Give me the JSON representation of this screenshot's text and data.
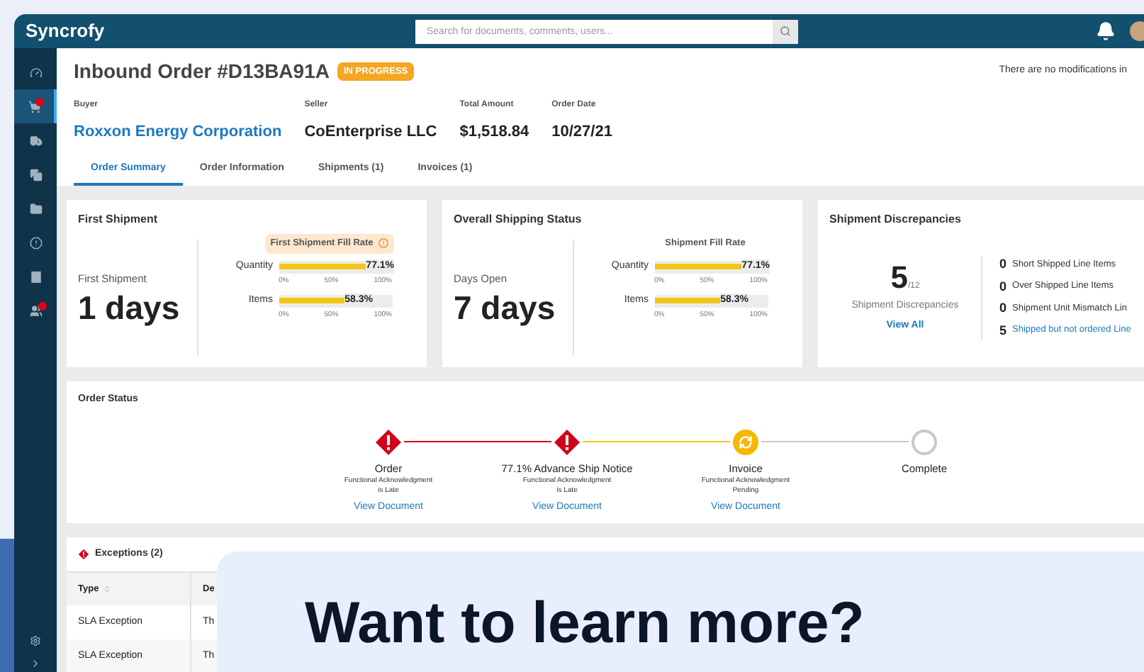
{
  "header": {
    "logo": "Syncrofy",
    "search_placeholder": "Search for documents, comments, users..."
  },
  "sidebar": {
    "items": [
      {
        "selected": false,
        "badge": false
      },
      {
        "selected": true,
        "badge": true
      },
      {
        "selected": false,
        "badge": false
      },
      {
        "selected": false,
        "badge": false
      },
      {
        "selected": false,
        "badge": false
      },
      {
        "selected": false,
        "badge": false
      },
      {
        "selected": false,
        "badge": false
      },
      {
        "selected": false,
        "badge": true
      }
    ]
  },
  "order": {
    "title": "Inbound Order #D13BA91A",
    "status": "IN PROGRESS",
    "note": "There are no modifications in",
    "meta": [
      {
        "label": "Buyer",
        "value": "Roxxon Energy Corporation",
        "link": true
      },
      {
        "label": "Seller",
        "value": "CoEnterprise LLC",
        "link": false
      },
      {
        "label": "Total Amount",
        "value": "$1,518.84",
        "link": false
      },
      {
        "label": "Order Date",
        "value": "10/27/21",
        "link": false
      }
    ],
    "tabs": [
      {
        "label": "Order Summary",
        "selected": true
      },
      {
        "label": "Order Information",
        "selected": false
      },
      {
        "label": "Shipments (1)",
        "selected": false
      },
      {
        "label": "Invoices (1)",
        "selected": false
      }
    ]
  },
  "summary_cards": [
    {
      "title": "First Shipment",
      "stat_label": "First Shipment",
      "stat_value": "1 days",
      "rate_title": "First Shipment Fill Rate",
      "warning": true,
      "bars": [
        {
          "label": "Quantity",
          "level": 0.771,
          "reading": "77.1%",
          "ticks": [
            "0%",
            "50%",
            "100%"
          ]
        },
        {
          "label": "Items",
          "level": 0.583,
          "reading": "58.3%",
          "ticks": [
            "0%",
            "50%",
            "100%"
          ]
        }
      ]
    },
    {
      "title": "Overall Shipping Status",
      "stat_label": "Days Open",
      "stat_value": "7 days",
      "rate_title": "Shipment Fill Rate",
      "warning": false,
      "bars": [
        {
          "label": "Quantity",
          "level": 0.771,
          "reading": "77.1%",
          "ticks": [
            "0%",
            "50%",
            "100%"
          ]
        },
        {
          "label": "Items",
          "level": 0.583,
          "reading": "58.3%",
          "ticks": [
            "0%",
            "50%",
            "100%"
          ]
        }
      ]
    }
  ],
  "discrepancies": {
    "title": "Shipment Discrepancies",
    "count": "5",
    "total": "/12",
    "label": "Shipment Discrepancies",
    "link": "View All",
    "items": [
      {
        "count": "0",
        "label": "Short Shipped Line Items",
        "link": false
      },
      {
        "count": "0",
        "label": "Over Shipped Line Items",
        "link": false
      },
      {
        "count": "0",
        "label": "Shipment Unit Mismatch Lin",
        "link": false
      },
      {
        "count": "5",
        "label": "Shipped but not ordered Line",
        "link": true
      }
    ]
  },
  "order_status": {
    "title": "Order Status",
    "steps": [
      {
        "name": "Order",
        "notes": [
          "Functional Acknowledgment",
          "is Late"
        ],
        "link": "View Document",
        "kind": "late"
      },
      {
        "name": "77.1% Advance Ship Notice",
        "notes": [
          "Functional Acknowledgment",
          "is Late"
        ],
        "link": "View Document",
        "kind": "late"
      },
      {
        "name": "Invoice",
        "notes": [
          "Functional Acknowledgment",
          "Pending"
        ],
        "link": "View Document",
        "kind": "pending"
      },
      {
        "name": "Complete",
        "kind": "todo"
      }
    ]
  },
  "exceptions": {
    "title": "Exceptions (2)",
    "columns": [
      "Type",
      "De"
    ],
    "rows": [
      [
        "SLA Exception",
        "Th"
      ],
      [
        "SLA Exception",
        "Th"
      ]
    ]
  },
  "promo": {
    "heading": "Want to learn more?"
  }
}
